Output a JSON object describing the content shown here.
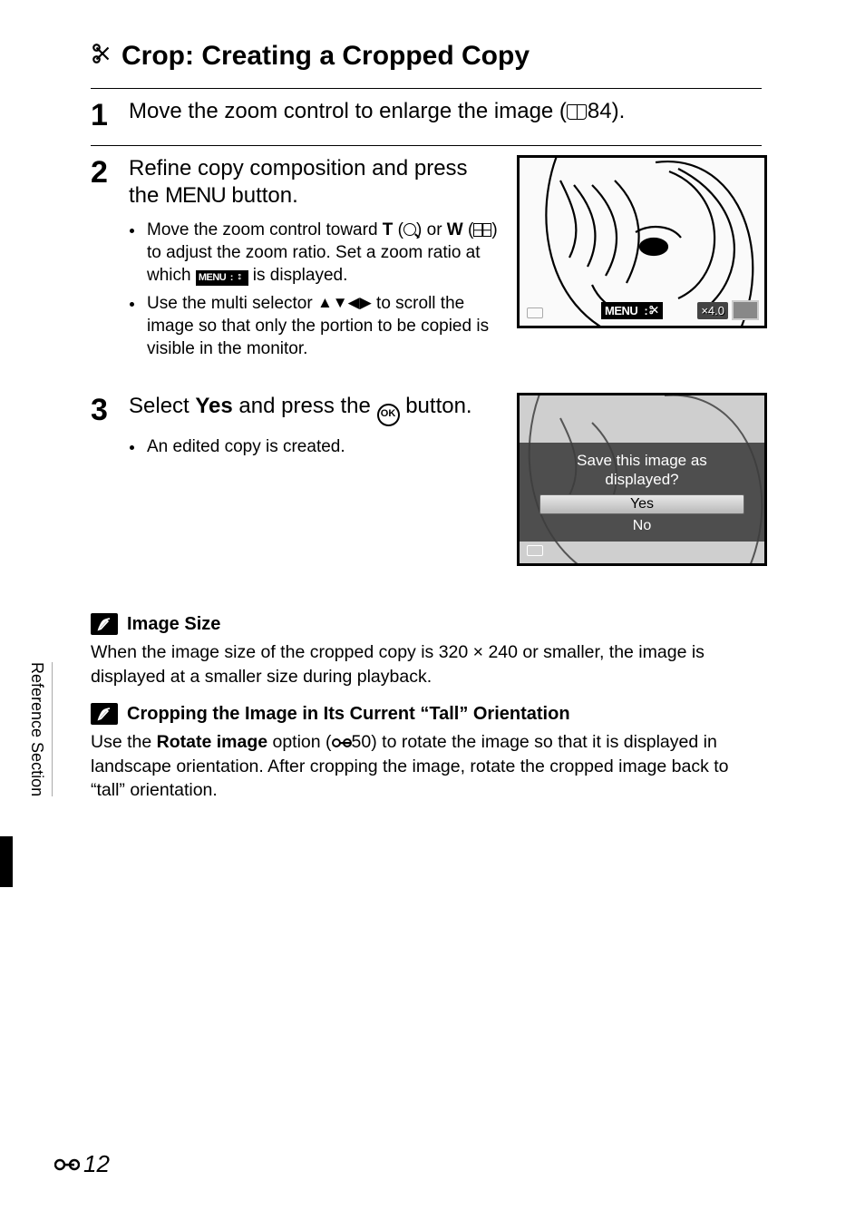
{
  "page": {
    "title_icon": "scissors-icon",
    "title": "Crop: Creating a Cropped Copy",
    "side_tab": "Reference Section",
    "page_number": "12",
    "ref_prefix_sym": "E"
  },
  "steps": [
    {
      "num": "1",
      "headline_pre": "Move the zoom control to enlarge the image (",
      "headline_ref": "84",
      "headline_post": ")."
    },
    {
      "num": "2",
      "headline_pre": "Refine copy composition and press the ",
      "headline_btn": "MENU",
      "headline_post": " button.",
      "bullets": [
        {
          "pre": "Move the zoom control toward ",
          "t_bold": "T",
          "t_post": " (",
          "t_icon": "magnify-in-icon",
          "t_close": ") or ",
          "w_bold": "W",
          "w_post": " (",
          "w_icon": "wide-icon",
          "w_close": ") to adjust the zoom ratio. Set a zoom ratio at which ",
          "menu_chip": "MENU",
          "scissor_chip": "s",
          "tail": " is displayed."
        },
        {
          "pre": "Use the multi selector ",
          "arrows": "▲▼◀▶",
          "post": " to scroll the image so that only the portion to be copied is visible in the monitor."
        }
      ],
      "illus": {
        "menu_chip": "MENU",
        "colon": ":",
        "zoom_label": "4.0"
      }
    },
    {
      "num": "3",
      "headline_pre": "Select ",
      "headline_bold": "Yes",
      "headline_mid": " and press the ",
      "headline_ok": "OK",
      "headline_post": " button.",
      "bullet": "An edited copy is created.",
      "dialog": {
        "question_l1": "Save this image as",
        "question_l2": "displayed?",
        "opt_yes": "Yes",
        "opt_no": "No"
      }
    }
  ],
  "notes": [
    {
      "title": "Image Size",
      "body": "When the image size of the cropped copy is 320 × 240 or smaller, the image is displayed at a smaller size during playback."
    },
    {
      "title": "Cropping the Image in Its Current “Tall” Orientation",
      "body_pre": "Use the ",
      "body_bold": "Rotate image",
      "body_mid": " option (",
      "body_ref": "50",
      "body_post": ") to rotate the image so that it is displayed in landscape orientation. After cropping the image, rotate the cropped image back to “tall” orientation."
    }
  ]
}
